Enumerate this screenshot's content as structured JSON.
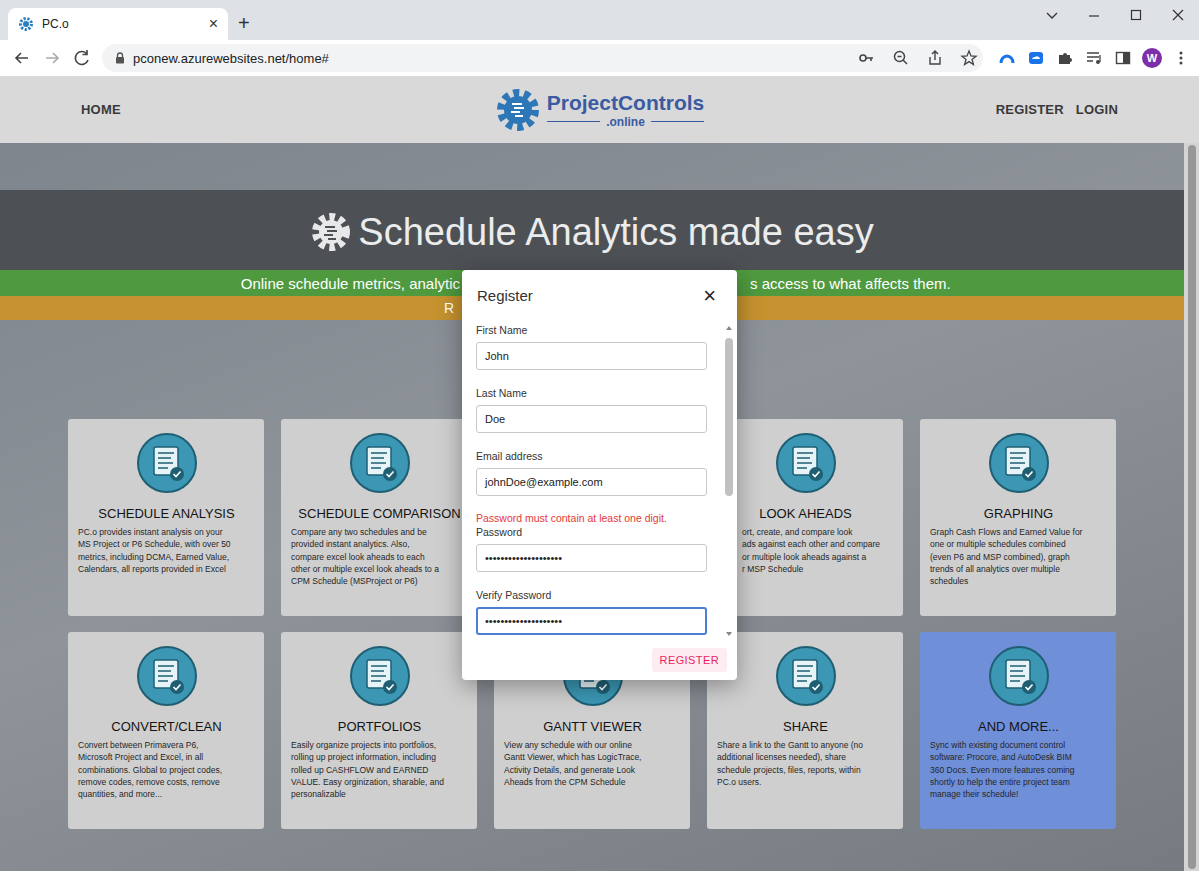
{
  "browser": {
    "tab": {
      "title": "PC.o",
      "close": "×"
    },
    "new_tab": "+",
    "url": "pconew.azurewebsites.net/home#",
    "profile": "W"
  },
  "nav": {
    "left": [
      "HOME"
    ],
    "logo": {
      "title": "ProjectControls",
      "sub": ".online"
    },
    "right": [
      "REGISTER",
      "LOGIN"
    ]
  },
  "hero": {
    "title": "Schedule Analytics made easy",
    "banner_left": "Online schedule metrics, analytic",
    "banner_right": "s access to what affects them.",
    "sub_banner_left": "R"
  },
  "cards": [
    {
      "kind": "normal",
      "highlighted": false,
      "title": "SCHEDULE ANALYSIS",
      "lines": [
        "PC.o provides instant analysis on your",
        "MS Project or P6 Schedule, with over 50",
        "metrics, including DCMA, Earned Value,",
        "Calendars, all reports provided in Excel"
      ]
    },
    {
      "kind": "normal",
      "highlighted": false,
      "title": "SCHEDULE COMPARISON",
      "lines": [
        "Compare any two schedules and be",
        "provided instant analytics. Also,",
        "compare excel look aheads to each",
        "other or multiple excel look aheads to a",
        "CPM Schedule (MSProject or P6)"
      ]
    },
    {
      "kind": "covered",
      "highlighted": false
    },
    {
      "kind": "covered-left",
      "highlighted": false,
      "title": "LOOK AHEADS",
      "lines": [
        "ort, create, and compare look",
        "ads against each other and compare",
        "or multiple look aheads against a",
        "r MSP Schedule"
      ]
    },
    {
      "kind": "normal",
      "highlighted": false,
      "title": "GRAPHING",
      "lines": [
        "Graph Cash Flows and Earned Value for",
        "one or multiple schedules combined",
        "(even P6 and MSP combined), graph",
        "trends of all analytics over multiple",
        "schedules"
      ]
    },
    {
      "kind": "normal",
      "highlighted": false,
      "title": "CONVERT/CLEAN",
      "lines": [
        "Convert between Primavera P6,",
        "Microsoft Project and Excel, in all",
        "combinations. Global to project codes,",
        "remove codes, remove costs, remove",
        "quantities, and more..."
      ]
    },
    {
      "kind": "normal",
      "highlighted": false,
      "title": "PORTFOLIOS",
      "lines": [
        "Easily organize projects into portfolios,",
        "rolling up project information, including",
        "rolled up CASHFLOW and EARNED",
        "VALUE. Easy orginization, sharable, and",
        "personalizable"
      ]
    },
    {
      "kind": "normal",
      "highlighted": false,
      "title": "GANTT VIEWER",
      "lines": [
        "View any schedule with our online",
        "Gantt Viewer, which has LogicTrace,",
        "Activity Details, and generate Look",
        "Aheads from the CPM Schedule"
      ]
    },
    {
      "kind": "normal",
      "highlighted": false,
      "title": "SHARE",
      "lines": [
        "Share a link to the Gantt to anyone (no",
        "additional licenses needed), share",
        "schedule projects, files, reports, within",
        "PC.o users."
      ]
    },
    {
      "kind": "normal",
      "highlighted": true,
      "title": "AND MORE...",
      "lines": [
        "Sync with existing document control",
        "software: Procore, and AutoDesk BIM",
        "360 Docs. Even more features coming",
        "shortly to help the entire project team",
        "manage their schedule!"
      ]
    }
  ],
  "dialog": {
    "title": "Register",
    "close": "×",
    "fields": [
      {
        "label": "First Name",
        "value": "John",
        "focused": false
      },
      {
        "label": "Last Name",
        "value": "Doe",
        "focused": false
      },
      {
        "label": "Email address",
        "value": "johnDoe@example.com",
        "focused": false
      },
      {
        "label": "Password",
        "value": "••••••••••••••••••••",
        "error": "Password must contain at least one digit.",
        "focused": false
      },
      {
        "label": "Verify Password",
        "value": "••••••••••••••••••••",
        "focused": true
      }
    ],
    "submit": "REGISTER"
  }
}
